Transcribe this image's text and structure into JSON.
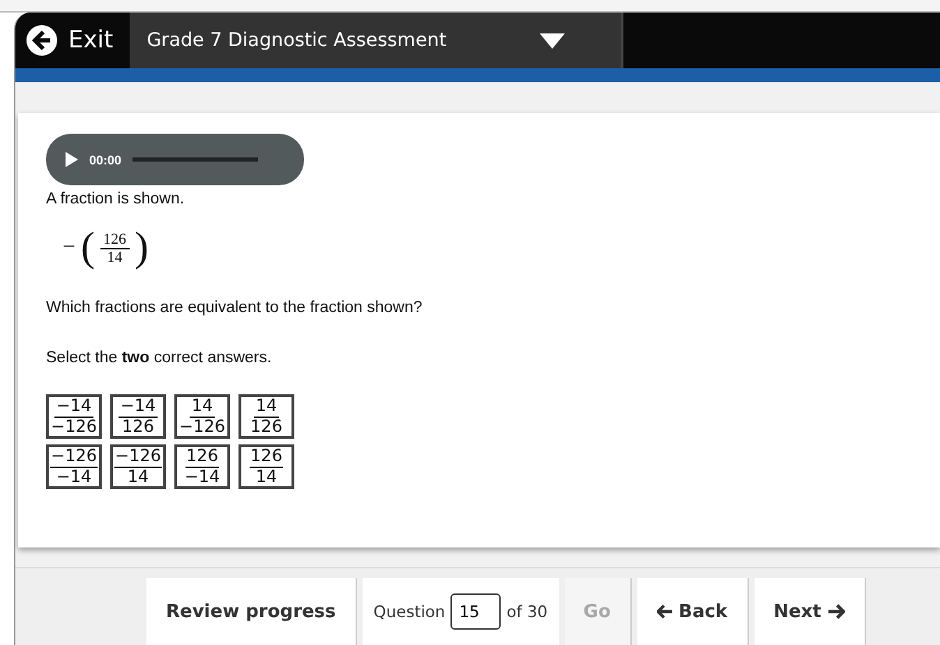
{
  "header": {
    "exit_label": "Exit",
    "title": "Grade 7 Diagnostic Assessment"
  },
  "player": {
    "time": "00:00"
  },
  "question": {
    "intro": "A fraction is shown.",
    "expression": {
      "sign": "−",
      "open": "(",
      "numerator": "126",
      "denominator": "14",
      "close": ")"
    },
    "prompt": "Which fractions are equivalent to the fraction shown?",
    "instruction": "Select the **two** correct answers.",
    "choices": [
      {
        "numerator": "−14",
        "denominator": "−126",
        "selected": false
      },
      {
        "numerator": "−14",
        "denominator": "126",
        "selected": false
      },
      {
        "numerator": "14",
        "denominator": "−126",
        "selected": false
      },
      {
        "numerator": "14",
        "denominator": "126",
        "selected": false
      },
      {
        "numerator": "−126",
        "denominator": "−14",
        "selected": false
      },
      {
        "numerator": "−126",
        "denominator": "14",
        "selected": false
      },
      {
        "numerator": "126",
        "denominator": "−14",
        "selected": false
      },
      {
        "numerator": "126",
        "denominator": "14",
        "selected": false
      }
    ]
  },
  "footer": {
    "review_label": "Review progress",
    "question_label": "Question",
    "question_value": "15",
    "total": "of 30",
    "go_label": "Go",
    "go_disabled": true,
    "back_label": "Back",
    "next_label": "Next"
  }
}
